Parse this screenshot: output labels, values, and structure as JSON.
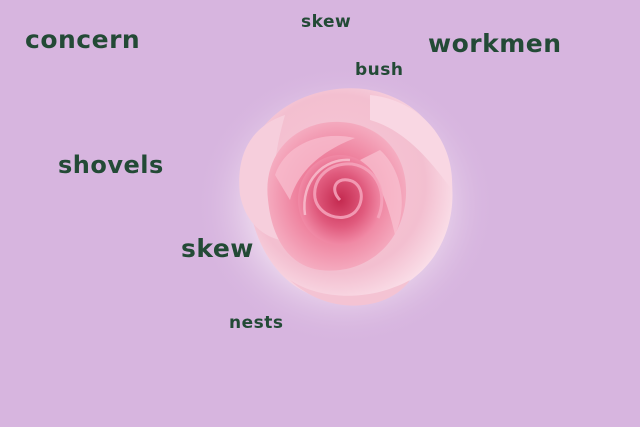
{
  "scene": {
    "background_color": "#d7b5df",
    "subject": "pink rose",
    "text_color": "#234a36"
  },
  "words": [
    {
      "id": "concern",
      "text": "concern"
    },
    {
      "id": "skew_top",
      "text": "skew"
    },
    {
      "id": "workmen",
      "text": "workmen"
    },
    {
      "id": "bush",
      "text": "bush"
    },
    {
      "id": "shovels",
      "text": "shovels"
    },
    {
      "id": "skew_mid",
      "text": "skew"
    },
    {
      "id": "nests",
      "text": "nests"
    }
  ]
}
